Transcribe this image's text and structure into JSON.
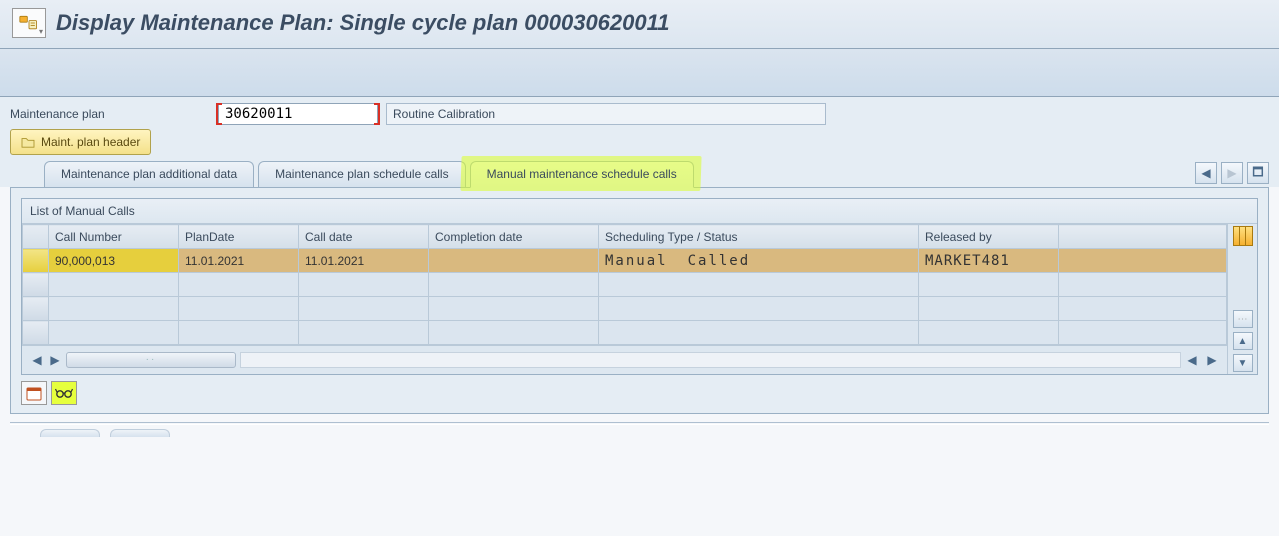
{
  "title": "Display Maintenance Plan: Single cycle plan 000030620011",
  "fields": {
    "plan_label": "Maintenance plan",
    "plan_number": "30620011",
    "plan_desc": "Routine Calibration"
  },
  "header_button": "Maint. plan header",
  "tabs": [
    {
      "label": "Maintenance plan additional data",
      "active": false,
      "highlight": false
    },
    {
      "label": "Maintenance plan schedule calls",
      "active": false,
      "highlight": false
    },
    {
      "label": "Manual maintenance schedule calls",
      "active": true,
      "highlight": true
    }
  ],
  "grid": {
    "title": "List of Manual Calls",
    "columns": [
      "Call Number",
      "PlanDate",
      "Call date",
      "Completion date",
      "Scheduling Type / Status",
      "Released by"
    ],
    "rows": [
      {
        "call_number": "90,000,013",
        "plan_date": "11.01.2021",
        "call_date": "11.01.2021",
        "completion_date": "",
        "sched_type": "Manual",
        "sched_status": "Called",
        "released_by": "MARKET481"
      }
    ]
  }
}
